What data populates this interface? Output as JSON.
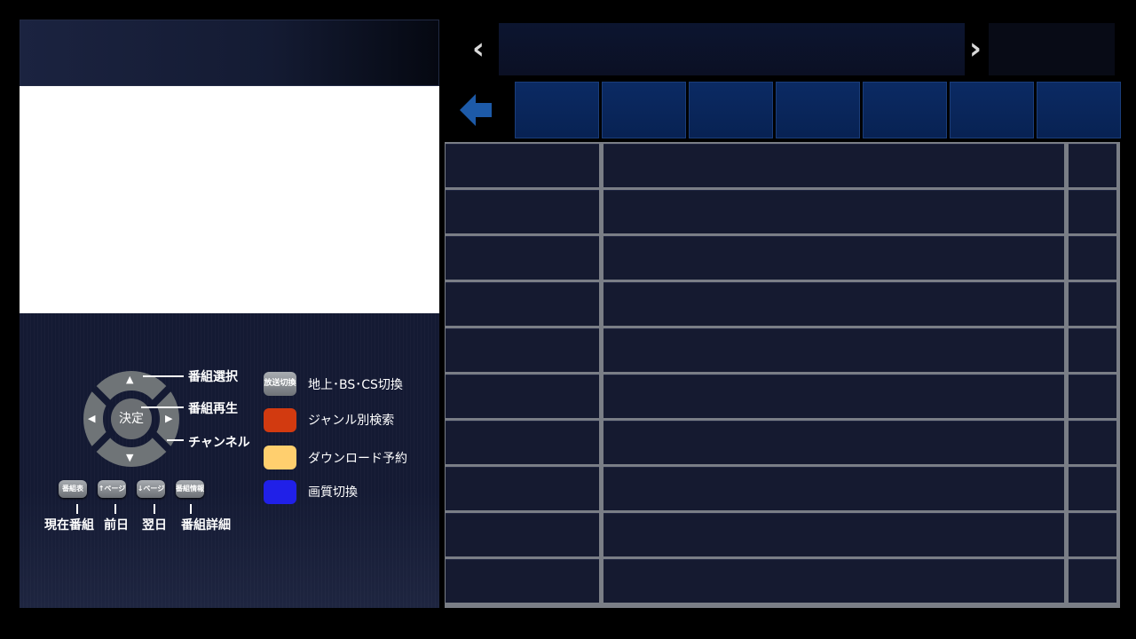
{
  "guide": {
    "dpad_center": "決定",
    "callouts": {
      "up": "番組選択",
      "center": "番組再生",
      "side": "チャンネル"
    },
    "small_buttons": [
      {
        "key": "番組表",
        "label": "現在番組"
      },
      {
        "key": "↑ページ",
        "label": "前日"
      },
      {
        "key": "↓ページ",
        "label": "翌日"
      },
      {
        "key": "番組情報",
        "label": "番組詳細"
      }
    ],
    "color_keys": [
      {
        "key": "放送切換",
        "label": "地上･BS･CS切換",
        "color": "#8a8e93"
      },
      {
        "key": "",
        "label": "ジャンル別検索",
        "color": "#d23a10"
      },
      {
        "key": "",
        "label": "ダウンロード予約",
        "color": "#ffcf6e"
      },
      {
        "key": "",
        "label": "画質切換",
        "color": "#2020e8"
      }
    ]
  },
  "header": {
    "prev_icon": "chevron-left-icon",
    "next_icon": "chevron-right-icon"
  },
  "colors": {
    "tab": "#0b2a63",
    "back_arrow": "#1d5aa8",
    "row": "#151a30"
  }
}
